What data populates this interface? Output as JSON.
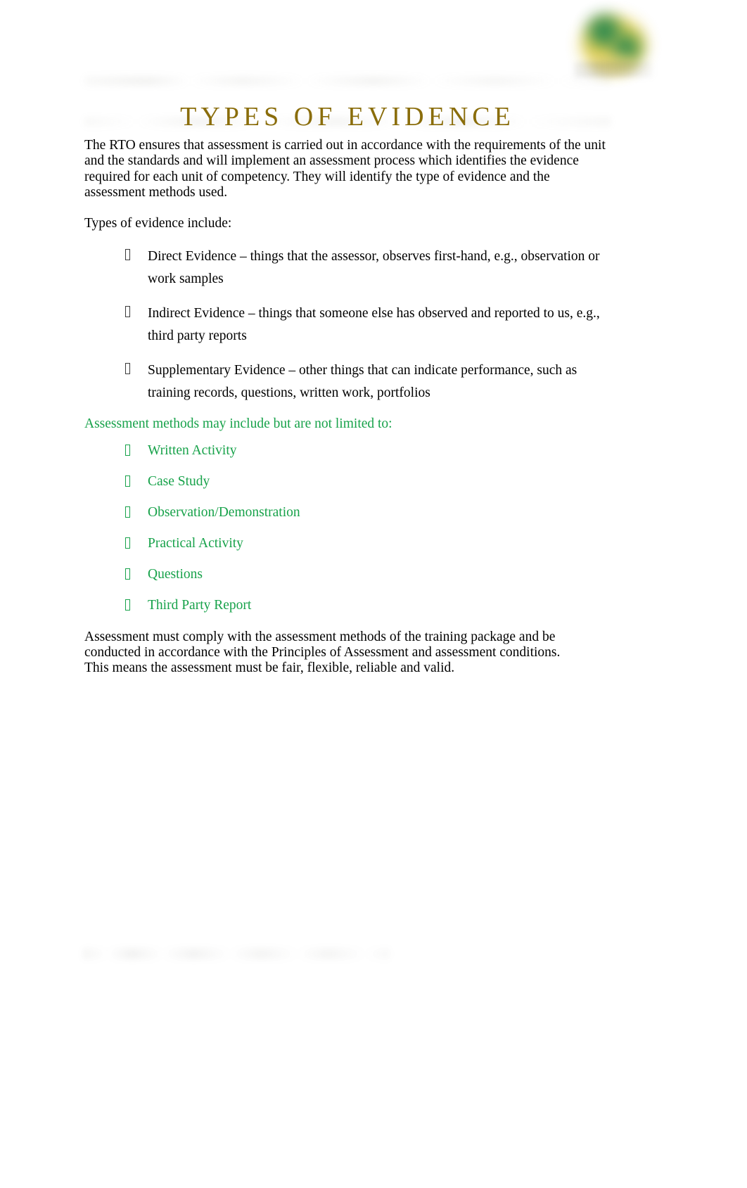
{
  "document": {
    "title": "TYPES OF EVIDENCE",
    "title_color": "#8a6d0b",
    "accent_green": "#17a24a",
    "logo": {
      "name": "organisation-logo",
      "description": "blurred green and yellow shield logo"
    },
    "header_band": "",
    "footer_band": "",
    "intro_paragraph": "The RTO ensures that assessment is carried out in accordance with the requirements of the unit and the standards and will implement an assessment process which identifies the evidence required for each unit of competency. They will identify the type of evidence and the assessment methods used.",
    "types_lead_in": "Types of evidence include:",
    "evidence_types": [
      {
        "bullet": "tofu-box-bullet",
        "text": "Direct Evidence – things that the assessor, observes first-hand, e.g., observation or work samples"
      },
      {
        "bullet": "tofu-box-bullet",
        "text": "Indirect Evidence – things that someone else has observed and reported to us, e.g., third party reports"
      },
      {
        "bullet": "tofu-box-bullet",
        "text": "Supplementary Evidence – other things that can indicate performance, such as training records, questions, written work, portfolios"
      }
    ],
    "methods_lead_in": "Assessment methods may include but are not limited to:",
    "assessment_methods": [
      {
        "bullet": "tofu-box-bullet",
        "text": "Written Activity"
      },
      {
        "bullet": "tofu-box-bullet",
        "text": "Case Study"
      },
      {
        "bullet": "tofu-box-bullet",
        "text": "Observation/Demonstration"
      },
      {
        "bullet": "tofu-box-bullet",
        "text": "Practical Activity"
      },
      {
        "bullet": "tofu-box-bullet",
        "text": "Questions"
      },
      {
        "bullet": "tofu-box-bullet",
        "text": "Third Party Report"
      }
    ],
    "closing_paragraph": "Assessment must comply with the assessment methods of the training package and be conducted in accordance with the Principles of Assessment and assessment conditions. This means the assessment must be fair, flexible, reliable and valid."
  }
}
